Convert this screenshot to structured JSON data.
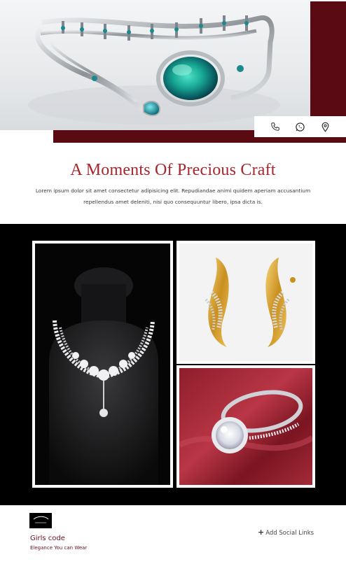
{
  "hero": {
    "image": "bangle-bracelet-with-opal-photo",
    "accent_color": "#5a0a12",
    "contact_icons": [
      "phone-icon",
      "whatsapp-icon",
      "location-pin-icon"
    ]
  },
  "intro": {
    "title": "A Moments Of Precious Craft",
    "description": "Lorem ipsum dolor sit amet consectetur adipisicing elit. Repudiandae animi quidem aperiam accusantium repellendus amet deleniti, nisi quo consequuntur libero, ipsa dicta is.",
    "title_color": "#a8252e"
  },
  "gallery": {
    "background": "#000000",
    "images": [
      "diamond-necklace-on-bust-photo",
      "gold-diamond-earrings-photo",
      "diamond-ring-on-red-satin-photo"
    ]
  },
  "footer": {
    "logo": "brand-logo",
    "brand_name": "Girls code",
    "tagline": "Elegance You can Wear",
    "add_social_label": "Add Social Links",
    "brand_color": "#6a0f1c"
  }
}
